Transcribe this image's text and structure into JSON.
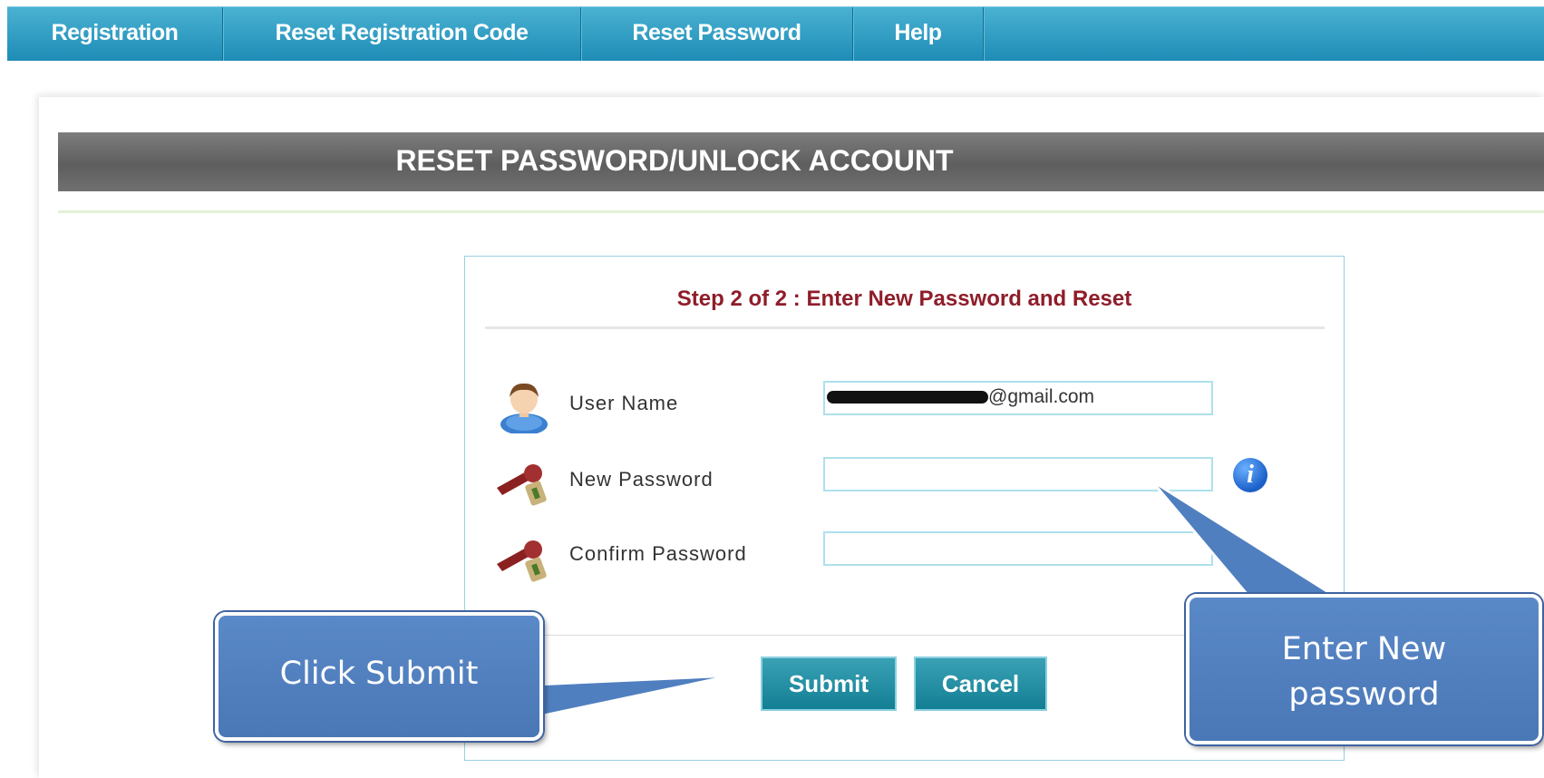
{
  "nav": {
    "items": [
      {
        "label": "Registration"
      },
      {
        "label": "Reset Registration Code"
      },
      {
        "label": "Reset Password"
      },
      {
        "label": "Help"
      }
    ]
  },
  "page": {
    "title": "RESET PASSWORD/UNLOCK ACCOUNT"
  },
  "form": {
    "step_title": "Step 2 of 2 : Enter New Password and Reset",
    "username_label": "User Name",
    "username_value": "@gmail.com",
    "new_password_label": "New Password",
    "new_password_value": "",
    "confirm_password_label": "Confirm Password",
    "confirm_password_value": "",
    "info_icon": "info-icon",
    "submit_label": "Submit",
    "cancel_label": "Cancel"
  },
  "callouts": {
    "submit": "Click Submit",
    "password": "Enter New password"
  },
  "colors": {
    "nav_bar": "#2a9cc4",
    "title_bar": "#6b6b6b",
    "step_title": "#8f1d2a",
    "button": "#1f8ea3",
    "callout": "#4f7fbf"
  }
}
